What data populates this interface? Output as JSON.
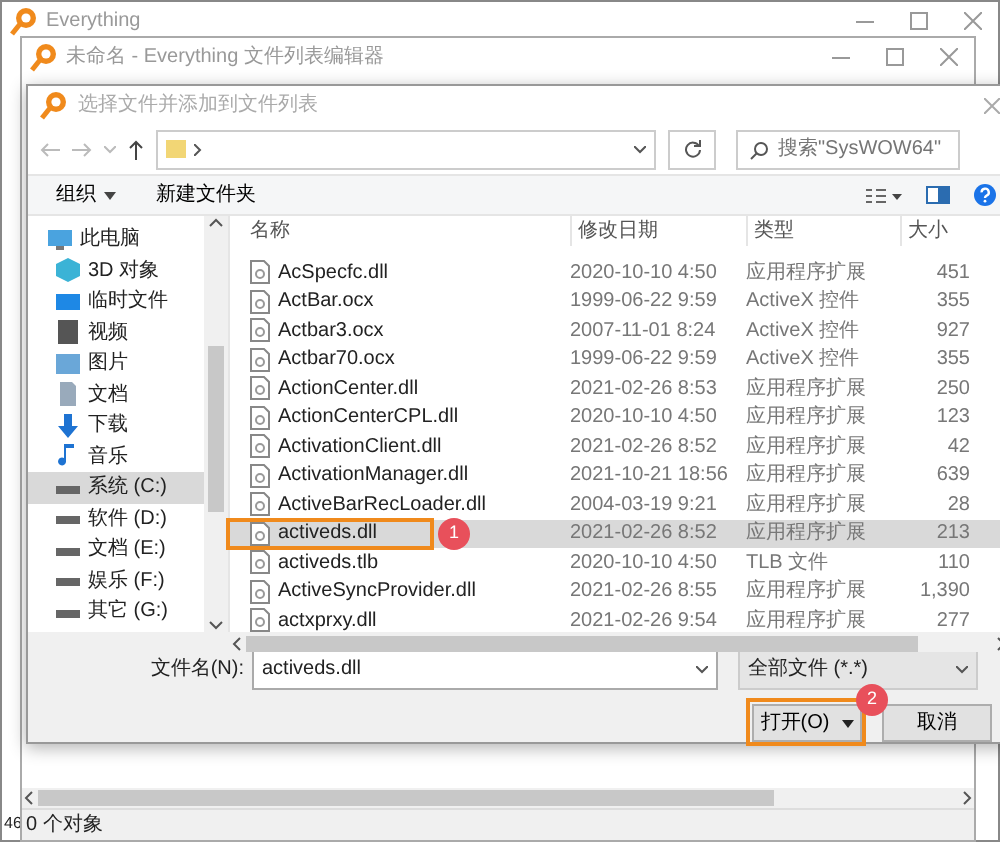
{
  "back_window": {
    "title": "Everything",
    "status_count": "46"
  },
  "editor_window": {
    "title": "未命名 - Everything 文件列表编辑器",
    "status": "0 个对象"
  },
  "dialog": {
    "title": "选择文件并添加到文件列表",
    "search": {
      "placeholder": "搜索\"SysWOW64\""
    },
    "toolbar": [
      "组织",
      "新建文件夹"
    ],
    "sidebar": [
      {
        "label": "此电脑",
        "kind": "pc",
        "selected": false,
        "children": [
          {
            "label": "3D 对象",
            "kind": "cube",
            "selected": false
          },
          {
            "label": "临时文件",
            "kind": "desktop",
            "selected": false
          },
          {
            "label": "视频",
            "kind": "video",
            "selected": false
          },
          {
            "label": "图片",
            "kind": "picture",
            "selected": false
          },
          {
            "label": "文档",
            "kind": "document",
            "selected": false
          },
          {
            "label": "下载",
            "kind": "download",
            "selected": false
          },
          {
            "label": "音乐",
            "kind": "music",
            "selected": false
          },
          {
            "label": "系统 (C:)",
            "kind": "drive",
            "selected": true
          },
          {
            "label": "软件 (D:)",
            "kind": "drive",
            "selected": false
          },
          {
            "label": "文档 (E:)",
            "kind": "drive",
            "selected": false
          },
          {
            "label": "娱乐 (F:)",
            "kind": "drive",
            "selected": false
          },
          {
            "label": "其它 (G:)",
            "kind": "drive",
            "selected": false
          }
        ]
      }
    ],
    "columns": [
      "名称",
      "修改日期",
      "类型",
      "大小"
    ],
    "files": [
      {
        "name": "AcSpecfc.dll",
        "date": "2020-10-10 4:50",
        "type": "应用程序扩展",
        "size": "451",
        "selected": false
      },
      {
        "name": "ActBar.ocx",
        "date": "1999-06-22 9:59",
        "type": "ActiveX 控件",
        "size": "355",
        "selected": false
      },
      {
        "name": "Actbar3.ocx",
        "date": "2007-11-01 8:24",
        "type": "ActiveX 控件",
        "size": "927",
        "selected": false
      },
      {
        "name": "Actbar70.ocx",
        "date": "1999-06-22 9:59",
        "type": "ActiveX 控件",
        "size": "355",
        "selected": false
      },
      {
        "name": "ActionCenter.dll",
        "date": "2021-02-26 8:53",
        "type": "应用程序扩展",
        "size": "250",
        "selected": false
      },
      {
        "name": "ActionCenterCPL.dll",
        "date": "2020-10-10 4:50",
        "type": "应用程序扩展",
        "size": "123",
        "selected": false
      },
      {
        "name": "ActivationClient.dll",
        "date": "2021-02-26 8:52",
        "type": "应用程序扩展",
        "size": "42",
        "selected": false
      },
      {
        "name": "ActivationManager.dll",
        "date": "2021-10-21 18:56",
        "type": "应用程序扩展",
        "size": "639",
        "selected": false
      },
      {
        "name": "ActiveBarRecLoader.dll",
        "date": "2004-03-19 9:21",
        "type": "应用程序扩展",
        "size": "28",
        "selected": false
      },
      {
        "name": "activeds.dll",
        "date": "2021-02-26 8:52",
        "type": "应用程序扩展",
        "size": "213",
        "selected": true
      },
      {
        "name": "activeds.tlb",
        "date": "2020-10-10 4:50",
        "type": "TLB 文件",
        "size": "110",
        "selected": false
      },
      {
        "name": "ActiveSyncProvider.dll",
        "date": "2021-02-26 8:55",
        "type": "应用程序扩展",
        "size": "1,390",
        "selected": false
      },
      {
        "name": "actxprxy.dll",
        "date": "2021-02-26 9:54",
        "type": "应用程序扩展",
        "size": "277",
        "selected": false
      }
    ],
    "filename_label": "文件名(N):",
    "filename": "activeds.dll",
    "filter": "全部文件 (*.*)",
    "buttons": {
      "open": "打开(O)",
      "cancel": "取消"
    }
  },
  "annotations": [
    {
      "label": "1"
    },
    {
      "label": "2"
    }
  ]
}
